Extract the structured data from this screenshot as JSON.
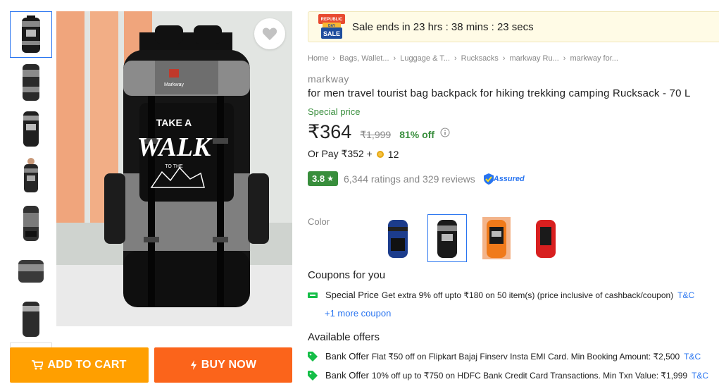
{
  "gallery": {
    "thumbnails": [
      {
        "color": "#1a1a1a"
      },
      {
        "color": "#2a2a2a"
      },
      {
        "color": "#1f1f1f"
      },
      {
        "color": "#262626"
      },
      {
        "color": "#303030"
      },
      {
        "color": "#3a3a3a"
      },
      {
        "color": "#2c2c2c"
      }
    ],
    "more_icon": "chevron-down-icon",
    "main_image": {
      "print_line1": "TAKE A",
      "print_line2": "WALK",
      "print_line3": "TO THE",
      "logo_text": "Markway"
    },
    "wishlist_icon": "heart-icon"
  },
  "actions": {
    "add_to_cart": "ADD TO CART",
    "buy_now": "BUY NOW",
    "cart_color": "#ff9f00",
    "buy_color": "#fb641b"
  },
  "sale": {
    "badge_line1": "REPUBLIC",
    "badge_line2": "DAY",
    "badge_line3": "SALE",
    "text": "Sale ends in 23 hrs : 38 mins : 23 secs"
  },
  "breadcrumbs": [
    "Home",
    "Bags, Wallet...",
    "Luggage & T...",
    "Rucksacks",
    "markway Ru...",
    "markway for..."
  ],
  "product": {
    "brand": "markway",
    "title": "for men travel tourist bag backpack for hiking trekking camping Rucksack - 70 L",
    "special_price_label": "Special price",
    "price": "₹364",
    "mrp": "₹1,999",
    "discount": "81% off",
    "or_pay_prefix": "Or Pay ₹352 +",
    "or_pay_coins": "12",
    "rating": "3.8",
    "rating_star": "★",
    "ratings_reviews": "6,344 ratings and 329 reviews",
    "assured": "Assured"
  },
  "color_selector": {
    "label": "Color",
    "options": [
      {
        "name": "blue",
        "color": "#1c3c8c",
        "selected": false
      },
      {
        "name": "black",
        "color": "#1a1a1a",
        "selected": true
      },
      {
        "name": "orange",
        "color": "#f07a1a",
        "selected": false
      },
      {
        "name": "red",
        "color": "#d81f1f",
        "selected": false
      }
    ]
  },
  "coupons": {
    "heading": "Coupons for you",
    "items": [
      {
        "title": "Special Price",
        "text": "Get extra 9% off upto ₹180 on 50 item(s) (price inclusive of cashback/coupon)",
        "tnc": "T&C"
      }
    ],
    "more": "+1 more coupon"
  },
  "offers": {
    "heading": "Available offers",
    "items": [
      {
        "title": "Bank Offer",
        "text": "Flat ₹50 off on Flipkart Bajaj Finserv Insta EMI Card. Min Booking Amount: ₹2,500",
        "tnc": "T&C"
      },
      {
        "title": "Bank Offer",
        "text": "10% off up to ₹750 on HDFC Bank Credit Card Transactions. Min Txn Value: ₹1,999",
        "tnc": "T&C"
      }
    ]
  },
  "colors": {
    "accent": "#2874f0",
    "green": "#388e3c"
  }
}
